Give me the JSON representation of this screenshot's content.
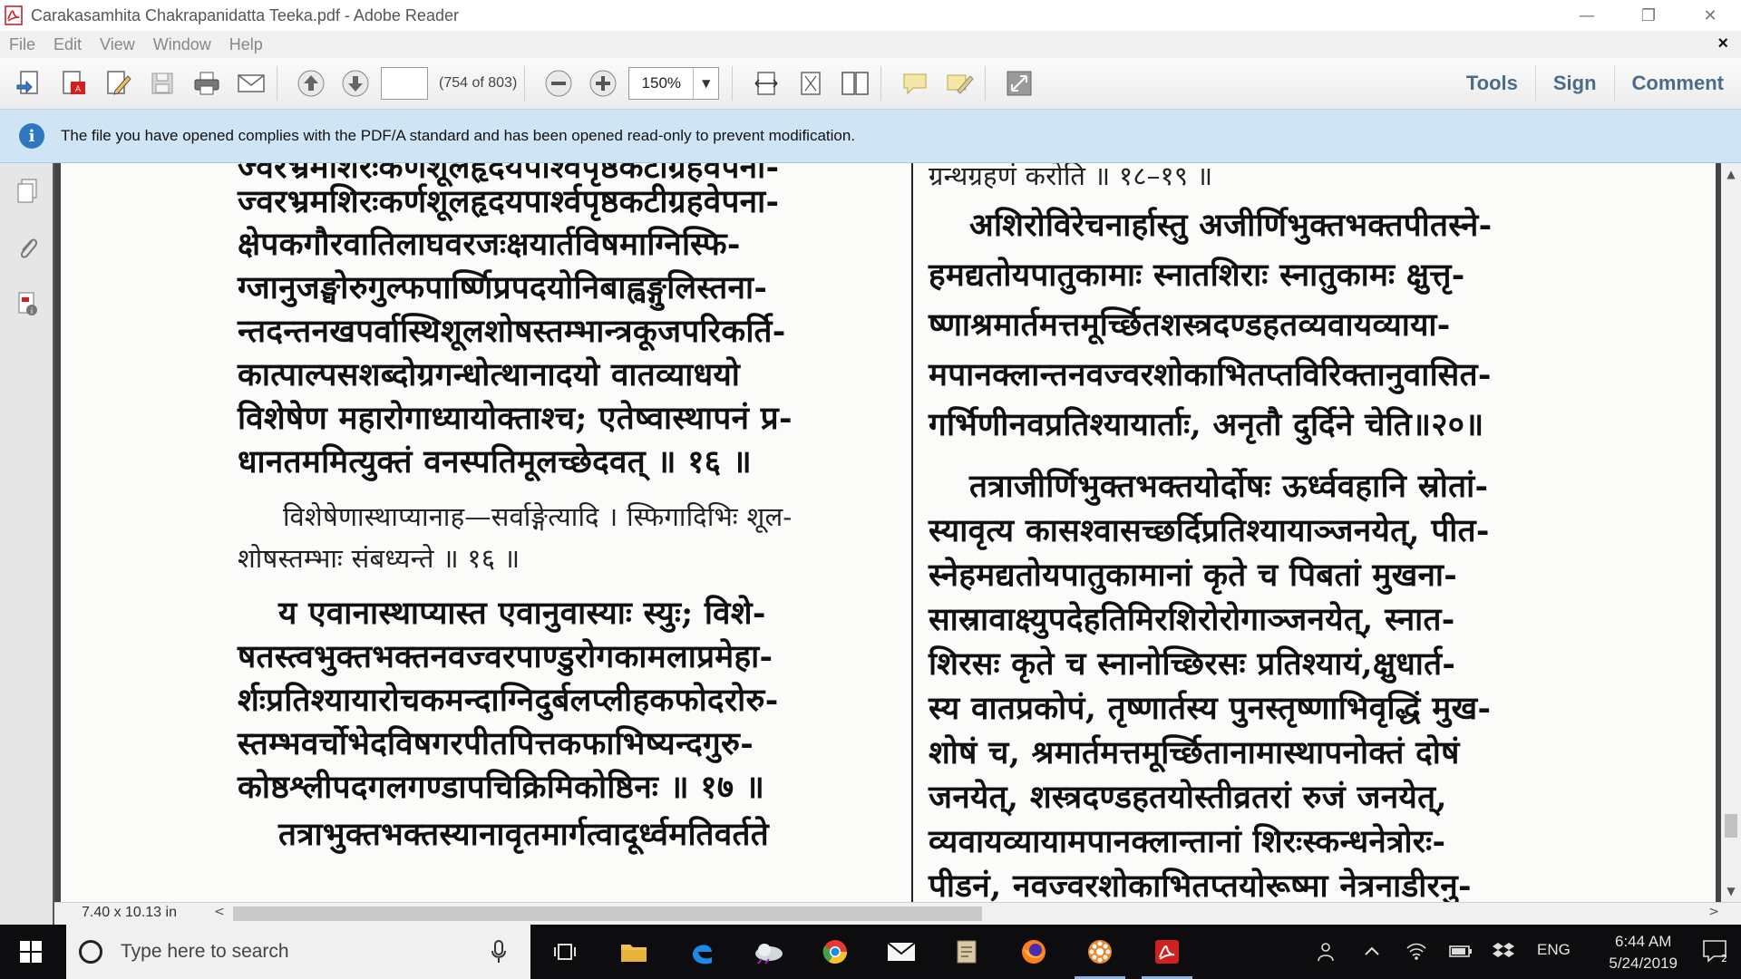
{
  "window": {
    "title": "Carakasamhita Chakrapanidatta Teeka.pdf - Adobe Reader",
    "controls": {
      "minimize": "—",
      "restore": "❐",
      "close": "✕"
    }
  },
  "menu": {
    "items": [
      "File",
      "Edit",
      "View",
      "Window",
      "Help"
    ],
    "close_doc": "×"
  },
  "toolbar": {
    "page_input": "",
    "page_count": "(754 of 803)",
    "zoom": "150%",
    "right_links": [
      "Tools",
      "Sign",
      "Comment"
    ]
  },
  "infobar": {
    "message": "The file you have opened complies with the PDF/A standard and has been opened read-only to prevent modification."
  },
  "document": {
    "left_column": [
      "ज्वरभ्रमशिरःकर्णशूलहृदयपार्श्वपृष्ठकटीग्रहवेपना-",
      "क्षेपकगौरवातिलाघवरजःक्षयार्तविषमाग्निस्फि-",
      "ग्जानुजङ्घोरुगुल्फपार्ष्णिप्रपदयोनिबाह्वङ्गुलिस्तना-",
      "न्तदन्तनखपर्वास्थिशूलशोषस्तम्भान्त्रकूजपरिकर्ति-",
      "कात्पाल्पसशब्दोग्रगन्धोत्थानादयो  वातव्याधयो",
      "विशेषेण महारोगाध्यायोक्ताश्च; एतेष्वास्थापनं प्र-",
      "धानतममित्युक्तं वनस्पतिमूलच्छेदवत् ॥ १६ ॥",
      "विशेषेणास्थाप्यानाह—सर्वाङ्गेत्यादि । स्फिगादिभिः शूल-",
      "शोषस्तम्भाः संबध्यन्ते ॥ १६ ॥",
      "य एवानास्थाप्यास्त एवानुवास्याः स्युः; विशे-",
      "षतस्त्वभुक्तभक्तनवज्वरपाण्डुरोगकामलाप्रमेहा-",
      "र्शःप्रतिश्यायारोचकमन्दाग्निदुर्बलप्लीहकफोदरोरु-",
      "स्तम्भवर्चोभेदविषगरपीतपित्तकफाभिष्यन्दगुरु-",
      "कोष्ठश्लीपदगलगण्डापचिक्रिमिकोष्ठिनः ॥ १७ ॥",
      "तत्राभुक्तभक्तस्यानावृतमार्गत्वादूर्ध्वमतिवर्तते"
    ],
    "right_column": [
      "ग्रन्थग्रहणं करोति ॥ १८–१९ ॥",
      "अशिरोविरेचनार्हास्तु  अजीर्णिभुक्तभक्तपीतस्ने-",
      "हमद्यतोयपातुकामाः स्नातशिराः स्नातुकामः क्षुत्तृ-",
      "ष्णाश्रमार्तमत्तमूर्च्छितशस्त्रदण्डहतव्यवायव्याया-",
      "मपानक्लान्तनवज्वरशोकाभितप्तविरिक्तानुवासित-",
      "गर्भिणीनवप्रतिश्यायार्ताः, अनृतौ दुर्दिने चेति॥२०॥",
      "तत्राजीर्णिभुक्तभक्तयोर्दोषः  ऊर्ध्ववहानि  स्रोतां-",
      "स्यावृत्य कासश्वासच्छर्दिप्रतिश्यायाञ्जनयेत्, पीत-",
      "स्नेहमद्यतोयपातुकामानां कृते च पिबतां मुखना-",
      "सास्रावाक्ष्युपदेहतिमिरशिरोरोगाञ्जनयेत्, स्नात-",
      "शिरसः कृते च स्नानोच्छिरसः प्रतिश्यायं,क्षुधार्त-",
      "स्य वातप्रकोपं, तृष्णार्तस्य पुनस्तृष्णाभिवृद्धिं मुख-",
      "शोषं च, श्रमार्तमत्तमूर्च्छितानामास्थापनोक्तं दोषं",
      "जनयेत्,  शस्त्रदण्डहतयोस्तीव्रतरां रुजं  जनयेत्,",
      "व्यवायव्यायामपानक्लान्तानां  शिरःस्कन्धनेत्रोरः-",
      "पीडनं, नवज्वरशोकाभितप्तयोरूष्मा नेत्रनाडीरनु-"
    ]
  },
  "statusbar": {
    "page_size": "7.40 x 10.13 in",
    "scroll_left": "<",
    "scroll_right": ">"
  },
  "taskbar": {
    "search_placeholder": "Type here to search",
    "tray": {
      "language": "ENG",
      "time": "6:44 AM",
      "date": "5/24/2019",
      "notifications": "2"
    }
  },
  "colors": {
    "infobar_bg": "#cfe4f5",
    "link_blue": "#4a6c8a",
    "taskbar_bg": "#0d0d10",
    "pdf_red": "#d21f1f"
  }
}
